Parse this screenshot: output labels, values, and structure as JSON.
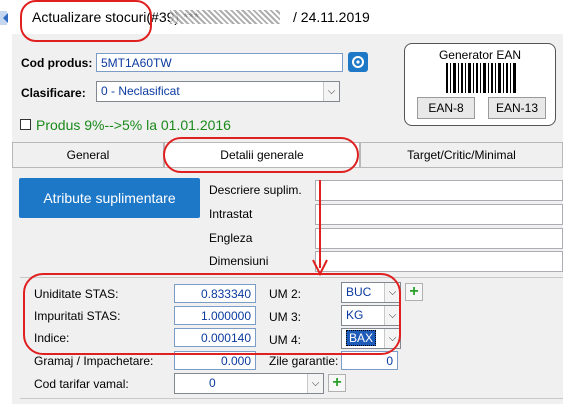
{
  "window": {
    "title": "Actualizare stocuri(#39) ***",
    "date_suffix": "/ 24.11.2019"
  },
  "header": {
    "cod_produs_label": "Cod produs:",
    "cod_produs_value": "5MT1A60TW",
    "clasificare_label": "Clasificare:",
    "clasificare_value": "0  -  Neclasificat",
    "tva_checkbox_label": "Produs 9%-->5% la 01.01.2016"
  },
  "ean": {
    "title": "Generator EAN",
    "btn_ean8": "EAN-8",
    "btn_ean13": "EAN-13"
  },
  "tabs": [
    {
      "label": "General"
    },
    {
      "label": "Detalii generale"
    },
    {
      "label": "Target/Critic/Minimal"
    }
  ],
  "detalii": {
    "attr_button": "Atribute suplimentare",
    "descriere_label": "Descriere suplim.",
    "intrastat_label": "Intrastat",
    "engleza_label": "Engleza",
    "dimensiuni_label": "Dimensiuni",
    "unitati": [
      {
        "label": "Uniditate STAS:",
        "value": "0.833340",
        "um_label": "UM 2:",
        "um_value": "BUC"
      },
      {
        "label": "Impuritati STAS:",
        "value": "1.000000",
        "um_label": "UM 3:",
        "um_value": "KG"
      },
      {
        "label": "Indice:",
        "value": "0.000140",
        "um_label": "UM 4:",
        "um_value": "BAX"
      }
    ],
    "gramaj_label": "Gramaj / Impachetare:",
    "gramaj_value": "0.000",
    "zile_label": "Zile garantie:",
    "zile_value": "0",
    "cod_tarifar_label": "Cod tarifar vamal:",
    "cod_tarifar_value": "0"
  },
  "colors": {
    "annotation": "#e02020",
    "accent_button": "#1e78c8",
    "green_text": "#1a8a1a"
  }
}
